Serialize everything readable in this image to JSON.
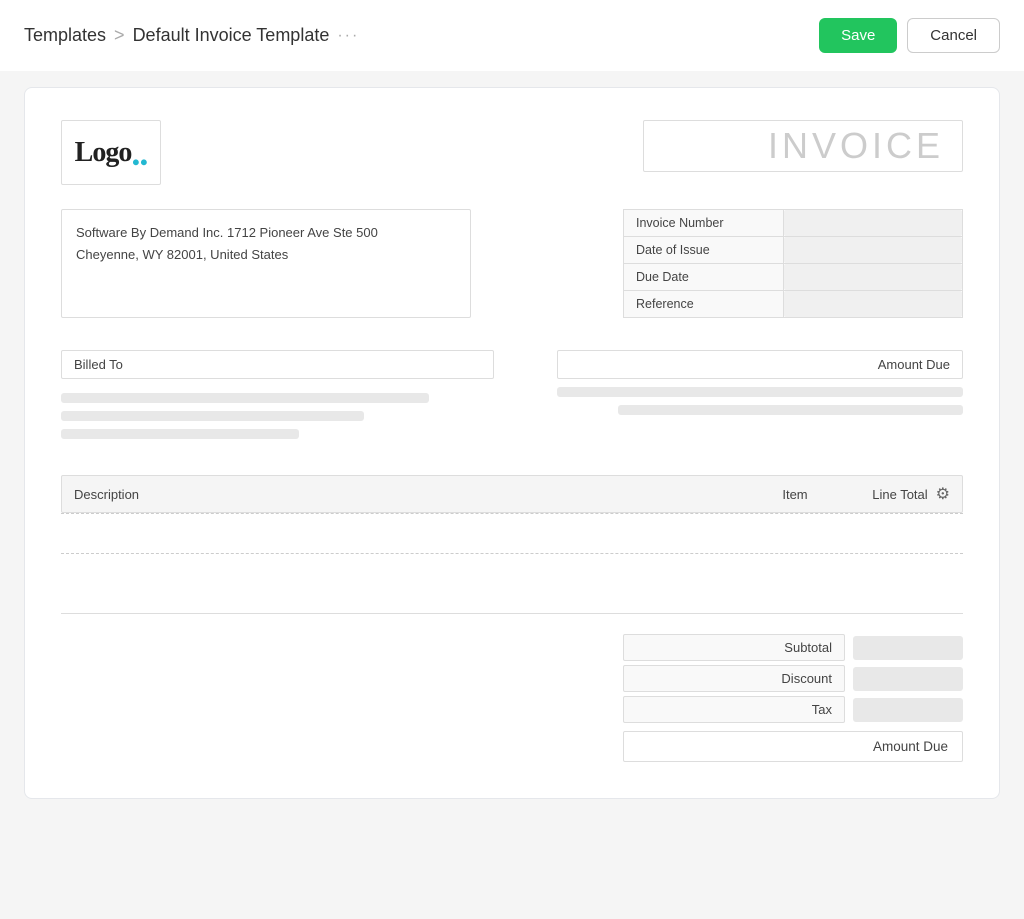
{
  "breadcrumb": {
    "parent": "Templates",
    "separator": ">",
    "current": "Default Invoice Template",
    "ellipsis": "···"
  },
  "toolbar": {
    "save_label": "Save",
    "cancel_label": "Cancel"
  },
  "invoice": {
    "title": "INVOICE",
    "logo_text": "Logo",
    "address_line1": "Software By Demand Inc. 1712 Pioneer Ave Ste 500",
    "address_line2": "Cheyenne, WY 82001, United States",
    "meta_fields": [
      {
        "label": "Invoice Number",
        "id": "invoice-number"
      },
      {
        "label": "Date of Issue",
        "id": "date-of-issue"
      },
      {
        "label": "Due Date",
        "id": "due-date"
      },
      {
        "label": "Reference",
        "id": "reference"
      }
    ],
    "billed_to_label": "Billed To",
    "amount_due_label": "Amount Due",
    "table_headers": {
      "description": "Description",
      "item": "Item",
      "line_total": "Line Total"
    },
    "totals": {
      "subtotal_label": "Subtotal",
      "discount_label": "Discount",
      "tax_label": "Tax",
      "amount_due_label": "Amount Due"
    }
  }
}
